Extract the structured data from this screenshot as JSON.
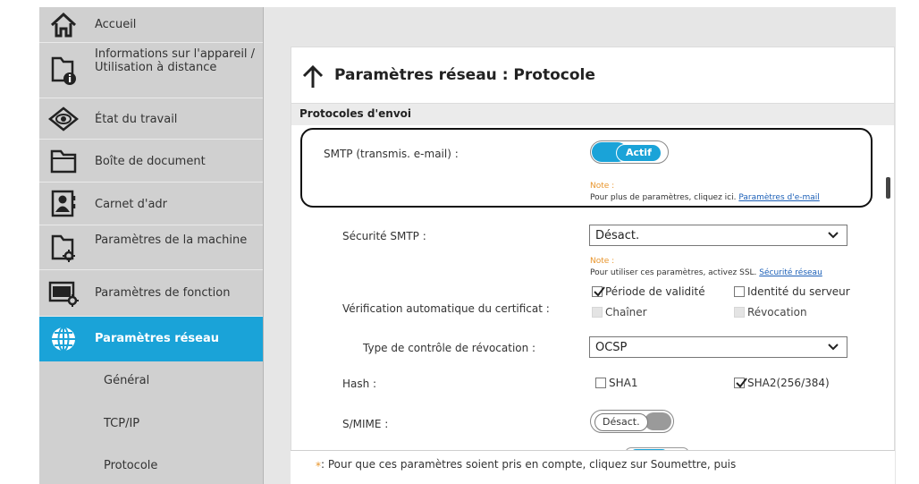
{
  "sidebar": {
    "items": [
      {
        "label": "Accueil",
        "icon": "home-icon"
      },
      {
        "label": "Informations sur l'appareil / Utilisation à distance",
        "icon": "device-info-icon"
      },
      {
        "label": "État du travail",
        "icon": "eye-icon"
      },
      {
        "label": "Boîte de document",
        "icon": "document-box-icon"
      },
      {
        "label": "Carnet d'adr",
        "icon": "address-book-icon"
      },
      {
        "label": "Paramètres de la machine",
        "icon": "machine-settings-icon"
      },
      {
        "label": "Paramètres de fonction",
        "icon": "function-settings-icon"
      },
      {
        "label": "Paramètres réseau",
        "icon": "globe-icon"
      }
    ],
    "subitems": [
      "Général",
      "TCP/IP",
      "Protocole"
    ]
  },
  "header": {
    "title": "Paramètres réseau : Protocole"
  },
  "section": {
    "title": "Protocoles d'envoi"
  },
  "smtp": {
    "label": "SMTP (transmis. e-mail) :",
    "toggle": "Actif",
    "note_title": "Note :",
    "note_text": "Pour plus de paramètres, cliquez ici. ",
    "note_link": "Paramètres d'e-mail"
  },
  "smtp_security": {
    "label": "Sécurité SMTP :",
    "value": "Désact.",
    "note_title": "Note :",
    "note_text": "Pour utiliser ces paramètres, activez SSL. ",
    "note_link": "Sécurité réseau"
  },
  "cert_check": {
    "label": "Vérification automatique du certificat :",
    "options": [
      {
        "label": "Période de validité",
        "checked": true
      },
      {
        "label": "Identité du serveur",
        "checked": false
      },
      {
        "label": "Chaîner",
        "checked": false
      },
      {
        "label": "Révocation",
        "checked": false
      }
    ]
  },
  "revocation": {
    "label": "Type de contrôle de révocation :",
    "value": "OCSP"
  },
  "hash": {
    "label": "Hash :",
    "options": [
      {
        "label": "SHA1",
        "checked": false
      },
      {
        "label": "SHA2(256/384)",
        "checked": true
      }
    ]
  },
  "smime": {
    "label": "S/MIME :",
    "toggle": "Désact."
  },
  "footer": {
    "star": "*",
    "text": ": Pour que ces paramètres soient pris en compte, cliquez sur Soumettre, puis"
  },
  "colors": {
    "accent": "#1aa3d8",
    "note": "#e8952c",
    "link": "#1b5fb7"
  }
}
